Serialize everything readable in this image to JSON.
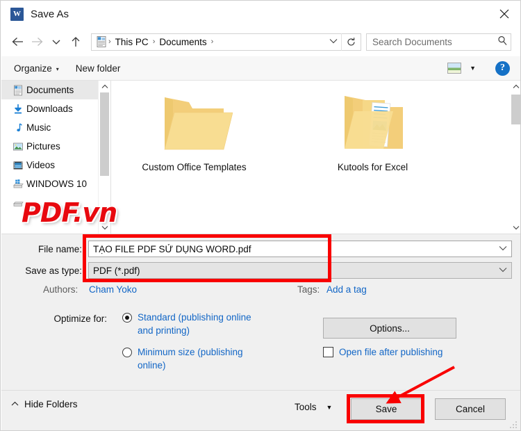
{
  "window": {
    "title": "Save As",
    "app_icon": "word-icon",
    "close_label": "✕"
  },
  "navbar": {
    "back": "←",
    "forward": "→",
    "recent": "⌄",
    "up": "↑",
    "address_icon": "documents-folder-icon",
    "breadcrumbs": [
      "This PC",
      "Documents"
    ],
    "separator": "›",
    "dropdown_caret": "⌄",
    "refresh": "↻",
    "search_placeholder": "Search Documents",
    "search_value": "",
    "search_icon": "🔎"
  },
  "toolbar": {
    "organize_label": "Organize",
    "organize_caret": "▾",
    "new_folder_label": "New folder",
    "view_icon": "picture-view-icon",
    "view_caret": "▼",
    "help_label": "?"
  },
  "navpane": {
    "items": [
      {
        "label": "Documents",
        "icon": "documents-icon",
        "selected": true
      },
      {
        "label": "Downloads",
        "icon": "downloads-icon",
        "selected": false
      },
      {
        "label": "Music",
        "icon": "music-icon",
        "selected": false
      },
      {
        "label": "Pictures",
        "icon": "pictures-icon",
        "selected": false
      },
      {
        "label": "Videos",
        "icon": "videos-icon",
        "selected": false
      },
      {
        "label": "WINDOWS 10",
        "icon": "drive-icon",
        "selected": false
      },
      {
        "label": "",
        "icon": "drive-icon",
        "selected": false
      }
    ],
    "scroll_up": "⌃",
    "scroll_down": "⌄"
  },
  "filepane": {
    "folders": [
      {
        "name": "Custom Office Templates",
        "icon": "folder-icon"
      },
      {
        "name": "Kutools for Excel",
        "icon": "folder-with-file-icon"
      }
    ],
    "scroll_up": "⌃",
    "scroll_down": "⌄"
  },
  "form": {
    "file_name_label": "File name:",
    "file_name_value": "TẠO FILE PDF SỬ DỤNG WORD.pdf",
    "save_as_type_label": "Save as type:",
    "save_as_type_value": "PDF (*.pdf)",
    "combo_caret": "⌄",
    "authors_label": "Authors:",
    "authors_value": "Cham Yoko",
    "tags_label": "Tags:",
    "tags_value": "Add a tag",
    "optimize_label": "Optimize for:",
    "optimize_options": [
      {
        "label": "Standard (publishing online and printing)",
        "checked": true
      },
      {
        "label": "Minimum size (publishing online)",
        "checked": false
      }
    ],
    "options_button": "Options...",
    "open_after_label": "Open file after publishing",
    "open_after_checked": false
  },
  "footer": {
    "hide_folders_caret": "⌃",
    "hide_folders_label": "Hide Folders",
    "tools_label": "Tools",
    "tools_caret": "▼",
    "save_label": "Save",
    "cancel_label": "Cancel"
  },
  "watermark": {
    "text_main": "PDF",
    "text_dot": ".",
    "text_tld": "vn"
  },
  "annotations": {
    "highlight_color": "#f90000",
    "boxes": [
      "file-name-and-type-fields",
      "save-button"
    ],
    "arrow": "points-to-save-button"
  }
}
